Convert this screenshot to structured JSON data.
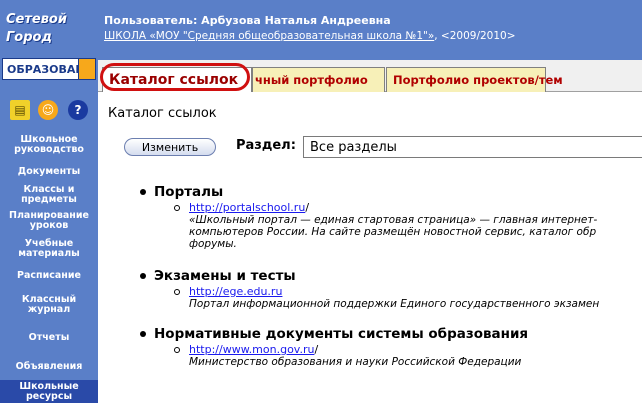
{
  "logo": {
    "line1": "Сетевой",
    "line2": "Город",
    "line3": "ОБРАЗОВАНИ"
  },
  "sidebar": {
    "icons": [
      "book-icon",
      "people-icon",
      "help-icon"
    ],
    "items": [
      {
        "label": "Школьное руководство"
      },
      {
        "label": "Документы"
      },
      {
        "label": "Классы и предметы"
      },
      {
        "label": "Планирование уроков"
      },
      {
        "label": "Учебные материалы"
      },
      {
        "label": "Расписание"
      },
      {
        "label": "Классный журнал"
      },
      {
        "label": "Отчеты"
      },
      {
        "label": "Объявления"
      },
      {
        "label": "Школьные ресурсы"
      }
    ]
  },
  "header": {
    "user": "Пользователь: Арбузова Наталья Андреевна",
    "school_link": "ШКОЛА «МОУ \"Средняя общеобразовательная школа №1\"»",
    "year": ", <2009/2010>"
  },
  "tabs": [
    {
      "label": "Каталог ссылок"
    },
    {
      "label": "чный портфолио"
    },
    {
      "label": "Портфолио проектов/тем"
    }
  ],
  "page": {
    "title": "Каталог ссылок",
    "edit_button": "Изменить",
    "section_label": "Раздел:",
    "section_value": "Все разделы"
  },
  "groups": [
    {
      "title": "Порталы",
      "url": "http://portalschool.ru",
      "desc1": "«Школьный портал — единая стартовая страница» — главная интернет-",
      "desc2": "компьютеров России. На сайте размещён новостной сервис, каталог обр",
      "desc3": "форумы."
    },
    {
      "title": "Экзамены и тесты",
      "url": "http://ege.edu.ru",
      "desc1": "Портал информационной поддержки Единого государственного экзамен"
    },
    {
      "title": "Нормативные документы системы образования",
      "url": "http://www.mon.gov.ru",
      "desc1": "Министерство образования и науки Российской Федерации"
    }
  ],
  "colors": {
    "sidebar": "#5a7fc8",
    "accent_red": "#d01010",
    "tab_bg": "#f7f0b8",
    "link": "#1a1aee"
  }
}
